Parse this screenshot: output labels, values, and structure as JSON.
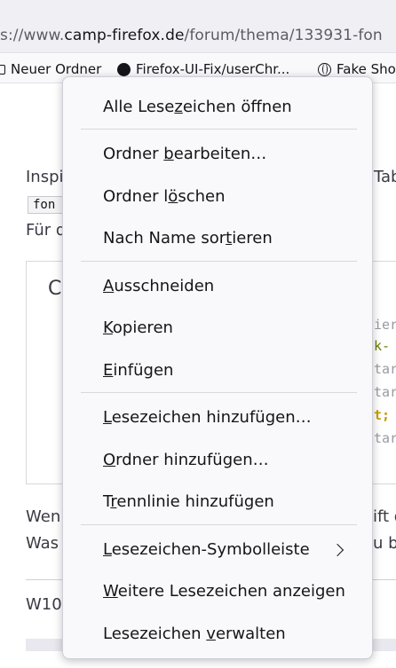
{
  "browser": {
    "url_prefix": "s://www.",
    "url_domain": "camp-firefox.de",
    "url_path": "/forum/thema/133931-fon",
    "bookmarks": [
      {
        "label": "Neuer Ordner",
        "icon": "folder-icon"
      },
      {
        "label": "Firefox-UI-Fix/userChr...",
        "icon": "github-icon"
      },
      {
        "label": "Fake Sho",
        "icon": "globe-icon"
      }
    ]
  },
  "page": {
    "line1_left": "Inspi",
    "line1_right": "Tab",
    "code_inline": "fon",
    "line2_left": "Für d",
    "codebox_title": "C",
    "code_lines": [
      "ier",
      "k-",
      "tar",
      "tar",
      "t;",
      "tar"
    ],
    "para1_left": "Wen",
    "para1_right": "ift d",
    "para2_left": "Was",
    "para2_right": "u be",
    "footer_left": "W10"
  },
  "context_menu": {
    "items": [
      {
        "label": "Alle Lesezeichen öffnen",
        "pre": "Alle Lese",
        "acc": "z",
        "post": "eichen öffnen"
      },
      {
        "label": "Ordner bearbeiten…",
        "pre": "Ordner ",
        "acc": "b",
        "post": "earbeiten…"
      },
      {
        "label": "Ordner löschen",
        "pre": "Ordner l",
        "acc": "ö",
        "post": "schen"
      },
      {
        "label": "Nach Name sortieren",
        "pre": "Nach Name sor",
        "acc": "t",
        "post": "ieren"
      },
      {
        "label": "Ausschneiden",
        "pre": "",
        "acc": "A",
        "post": "usschneiden"
      },
      {
        "label": "Kopieren",
        "pre": "",
        "acc": "K",
        "post": "opieren"
      },
      {
        "label": "Einfügen",
        "pre": "",
        "acc": "E",
        "post": "infügen"
      },
      {
        "label": "Lesezeichen hinzufügen…",
        "pre": "",
        "acc": "L",
        "post": "esezeichen hinzufügen…"
      },
      {
        "label": "Ordner hinzufügen…",
        "pre": "",
        "acc": "O",
        "post": "rdner hinzufügen…"
      },
      {
        "label": "Trennlinie hinzufügen",
        "pre": "T",
        "acc": "r",
        "post": "ennlinie hinzufügen"
      },
      {
        "label": "Lesezeichen-Symbolleiste",
        "pre": "",
        "acc": "L",
        "post": "esezeichen-Symbolleiste",
        "submenu": true
      },
      {
        "label": "Weitere Lesezeichen anzeigen",
        "pre": "",
        "acc": "W",
        "post": "eitere Lesezeichen anzeigen"
      },
      {
        "label": "Lesezeichen verwalten",
        "pre": "Lesezeichen ",
        "acc": "v",
        "post": "erwalten"
      }
    ]
  },
  "colors": {
    "menu_bg": "#f9f9fb",
    "menu_border": "#cfcfd8",
    "text": "#15141a",
    "toolbar_bg": "#f0f0f4",
    "code_green": "#6a7a00",
    "code_gold": "#c89b00",
    "code_gray": "#9a9aa2"
  }
}
